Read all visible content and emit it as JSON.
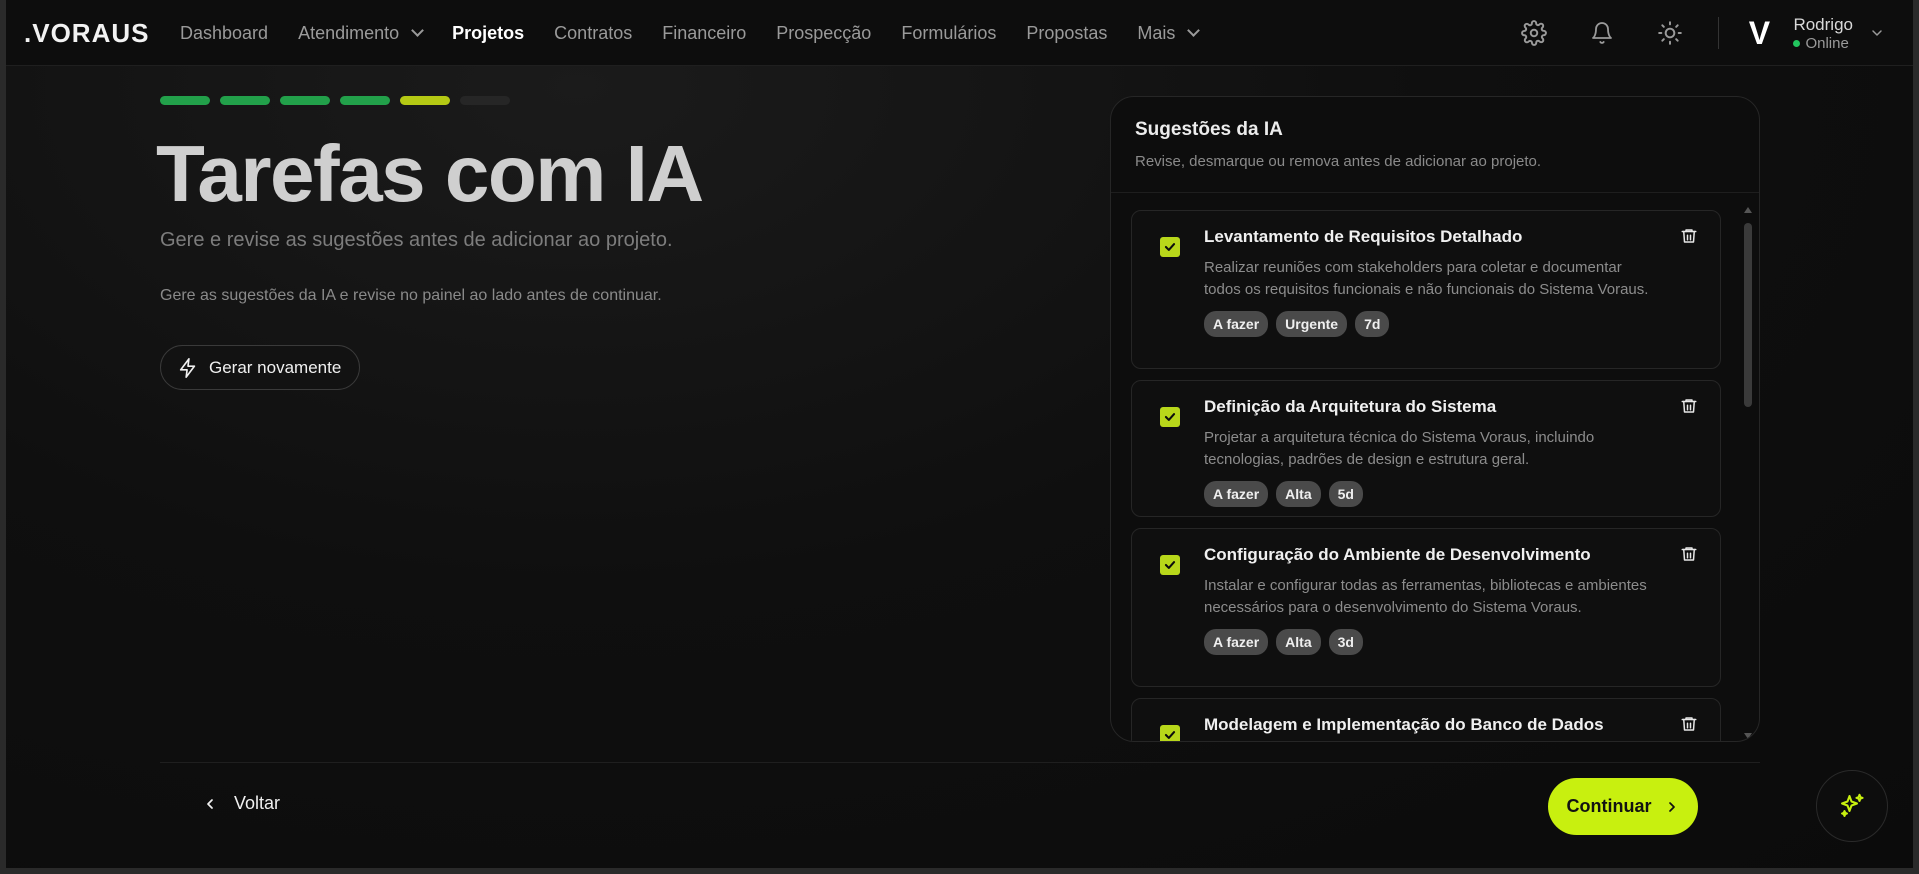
{
  "brand": {
    "logo": ".VORAUS"
  },
  "nav": {
    "items": [
      {
        "label": "Dashboard",
        "active": false,
        "has_dropdown": false
      },
      {
        "label": "Atendimento",
        "active": false,
        "has_dropdown": true
      },
      {
        "label": "Projetos",
        "active": true,
        "has_dropdown": false
      },
      {
        "label": "Contratos",
        "active": false,
        "has_dropdown": false
      },
      {
        "label": "Financeiro",
        "active": false,
        "has_dropdown": false
      },
      {
        "label": "Prospecção",
        "active": false,
        "has_dropdown": false
      },
      {
        "label": "Formulários",
        "active": false,
        "has_dropdown": false
      },
      {
        "label": "Propostas",
        "active": false,
        "has_dropdown": false
      },
      {
        "label": "Mais",
        "active": false,
        "has_dropdown": true
      }
    ],
    "icons": [
      "gear-icon",
      "bell-icon",
      "sun-icon"
    ]
  },
  "user": {
    "avatar_letter": "V",
    "name": "Rodrigo",
    "status": "Online",
    "status_color": "#22c55e"
  },
  "steps": {
    "total": 6,
    "completed": 4,
    "current": 5
  },
  "page": {
    "title": "Tarefas com IA",
    "subtitle": "Gere e revise as sugestões antes de adicionar ao projeto.",
    "hint": "Gere as sugestões da IA e revise no painel ao lado antes de continuar.",
    "regenerate_label": "Gerar novamente"
  },
  "panel": {
    "title": "Sugestões da IA",
    "description": "Revise, desmarque ou remova antes de adicionar ao projeto.",
    "suggestions": [
      {
        "checked": true,
        "title": "Levantamento de Requisitos Detalhado",
        "description": "Realizar reuniões com stakeholders para coletar e documentar todos os requisitos funcionais e não funcionais do Sistema Voraus.",
        "tags": [
          "A fazer",
          "Urgente",
          "7d"
        ]
      },
      {
        "checked": true,
        "title": "Definição da Arquitetura do Sistema",
        "description": "Projetar a arquitetura técnica do Sistema Voraus, incluindo tecnologias, padrões de design e estrutura geral.",
        "tags": [
          "A fazer",
          "Alta",
          "5d"
        ]
      },
      {
        "checked": true,
        "title": "Configuração do Ambiente de Desenvolvimento",
        "description": "Instalar e configurar todas as ferramentas, bibliotecas e ambientes necessários para o desenvolvimento do Sistema Voraus.",
        "tags": [
          "A fazer",
          "Alta",
          "3d"
        ]
      },
      {
        "checked": true,
        "title": "Modelagem e Implementação do Banco de Dados",
        "description": "",
        "tags": []
      }
    ]
  },
  "footer": {
    "back_label": "Voltar",
    "continue_label": "Continuar"
  },
  "colors": {
    "accent": "#c8f00f",
    "step_done": "#22a04a",
    "step_current": "#b5c914"
  }
}
